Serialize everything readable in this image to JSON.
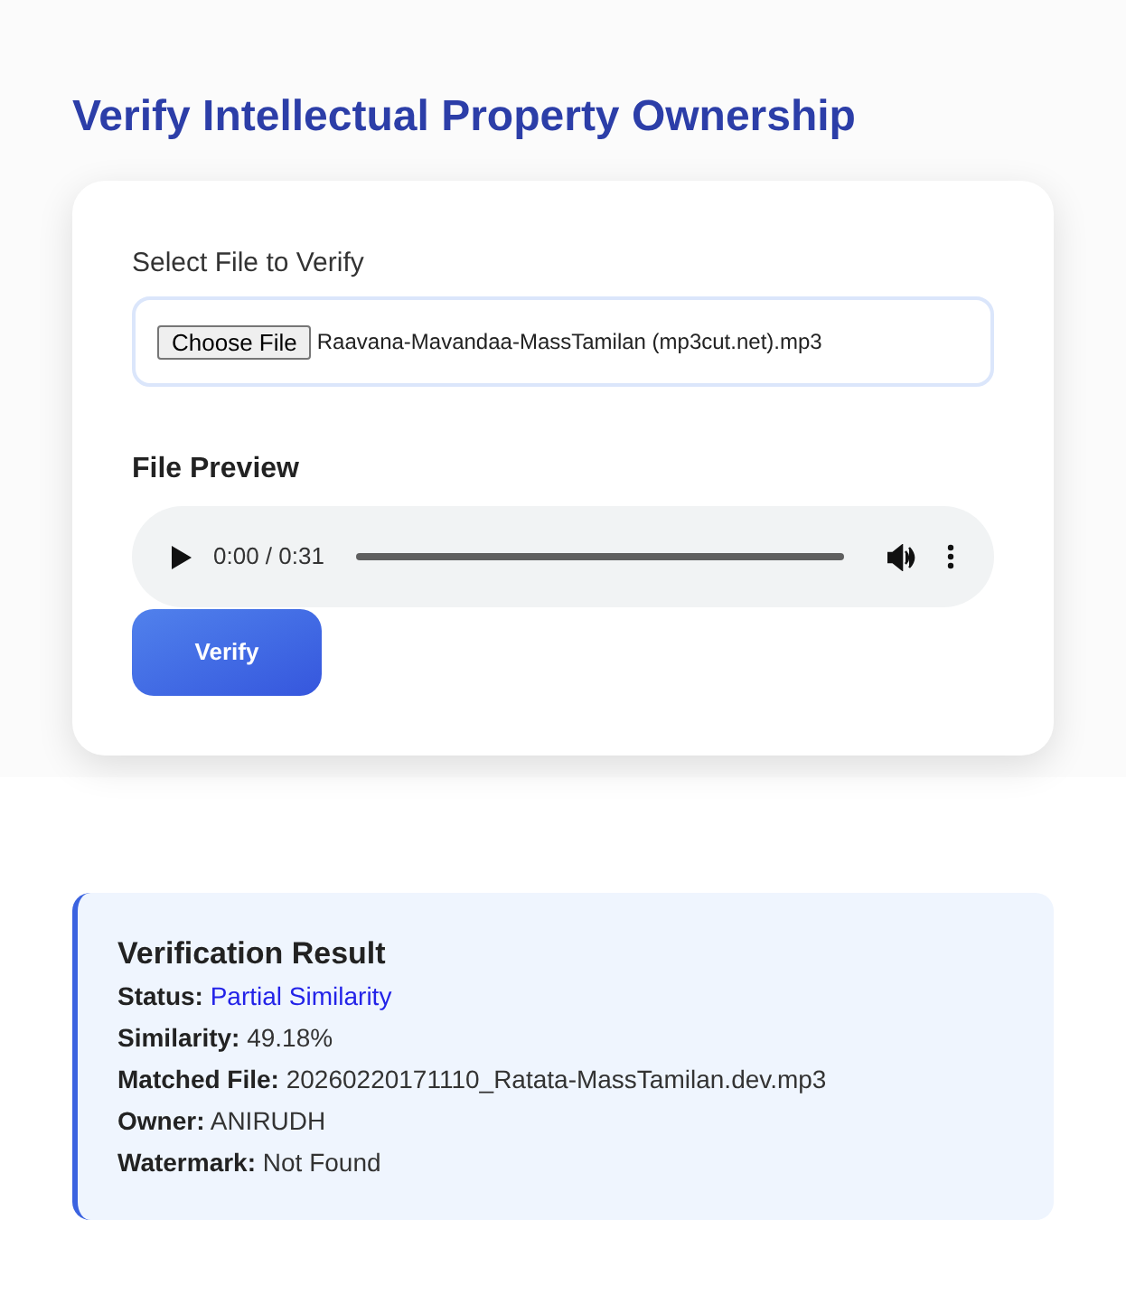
{
  "title": "Verify Intellectual Property Ownership",
  "form": {
    "file_label": "Select File to Verify",
    "choose_button": "Choose File",
    "file_name": "Raavana-Mavandaa-MassTamilan (mp3cut.net).mp3",
    "preview_label": "File Preview",
    "player": {
      "time": "0:00 / 0:31"
    },
    "verify_button": "Verify"
  },
  "result": {
    "title": "Verification Result",
    "rows": [
      {
        "label": "Status:",
        "value": "Partial Similarity",
        "kind": "status"
      },
      {
        "label": "Similarity:",
        "value": "49.18%",
        "kind": "plain"
      },
      {
        "label": "Matched File:",
        "value": "20260220171110_Ratata-MassTamilan.dev.mp3",
        "kind": "plain"
      },
      {
        "label": "Owner:",
        "value": "ANIRUDH",
        "kind": "plain"
      },
      {
        "label": "Watermark:",
        "value": "Not Found",
        "kind": "plain"
      }
    ]
  }
}
